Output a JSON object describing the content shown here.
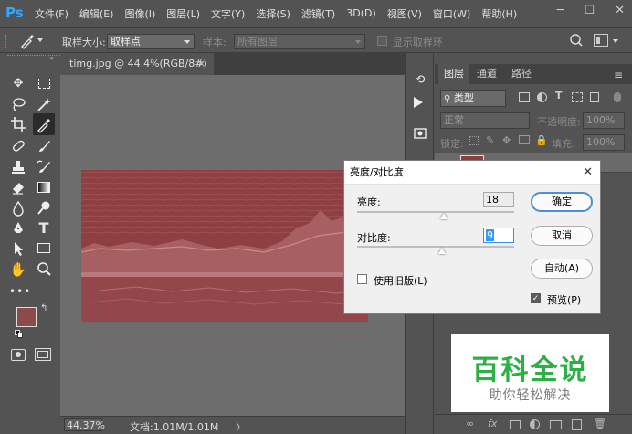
{
  "app": {
    "logo": "Ps"
  },
  "menu": [
    "文件(F)",
    "编辑(E)",
    "图像(I)",
    "图层(L)",
    "文字(Y)",
    "选择(S)",
    "滤镜(T)",
    "3D(D)",
    "视图(V)",
    "窗口(W)",
    "帮助(H)"
  ],
  "window_controls": {
    "minimize": "─",
    "maximize": "☐",
    "close": "✕"
  },
  "options": {
    "sample_size_label": "取样大小:",
    "sample_size_value": "取样点",
    "sample_label": "样本:",
    "sample_value": "所有图层",
    "show_ring_label": "显示取样环"
  },
  "document": {
    "tab_title": "timg.jpg @ 44.4%(RGB/8#) *",
    "tab_close": "×",
    "zoom": "44.37%",
    "doc_info": "文档:1.01M/1.01M",
    "status_arrow": "〉"
  },
  "layers_panel": {
    "tabs": [
      "图层",
      "通道",
      "路径"
    ],
    "filter_kind": "类型",
    "blend_mode": "正常",
    "opacity_label": "不透明度:",
    "opacity_value": "100%",
    "lock_label": "锁定:",
    "fill_label": "填充:",
    "fill_value": "100%"
  },
  "dialog": {
    "title": "亮度/对比度",
    "brightness_label": "亮度:",
    "brightness_value": "18",
    "contrast_label": "对比度:",
    "contrast_value": "9",
    "legacy_label": "使用旧版(L)",
    "ok": "确定",
    "cancel": "取消",
    "auto": "自动(A)",
    "preview_label": "预览(P)",
    "close": "✕",
    "legacy_checked": false,
    "preview_checked": true
  },
  "watermark": {
    "line1": "百科全说",
    "line2": "助你轻松解决"
  },
  "colors": {
    "foreground": "#8c4a4a",
    "background": "#6a2e2e",
    "image_tint": "#8e3f42",
    "watermark_green": "#2db043"
  }
}
